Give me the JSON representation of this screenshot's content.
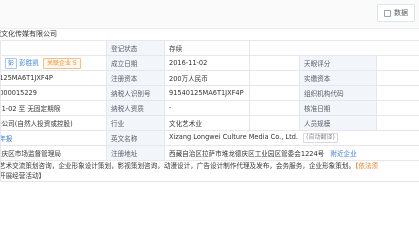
{
  "toolbar": {
    "export_label": "数据"
  },
  "company": {
    "name_partial": "瓏文化传媒有限公司"
  },
  "rows": [
    {
      "label1_partial": "",
      "value1": "",
      "label2": "登记状态",
      "value2": "存续",
      "label3": "",
      "value3": ""
    },
    {
      "legal_name_partial": "彭胜凯",
      "related_tag": "关联企业 5",
      "label2": "成立日期",
      "value2": "2016-11-02",
      "label3": "天眼评分",
      "value3": ""
    },
    {
      "value1_partial": "0125MA6T1JXF4P",
      "label2": "注册资本",
      "value2": "200万人民币",
      "label3": "实缴资本",
      "value3": ""
    },
    {
      "value1_partial": "2000015229",
      "label2": "纳税人识别号",
      "value2": "91540125MA6T1JXF4P",
      "label3": "组织机构代码",
      "value3": ""
    },
    {
      "value1_partial": "-11-02 至 无固定期限",
      "label2": "纳税人资质",
      "value2": "-",
      "label3": "核准日期",
      "value3": ""
    },
    {
      "value1_partial": "任公司(自然人投资或控股)",
      "label2": "行业",
      "value2": "文化艺术业",
      "label3": "人员规模",
      "value3": ""
    },
    {
      "value1_partial": "3年报",
      "label2": "英文名称",
      "value2": "Xizang Longwei Culture Media Co., Ltd.",
      "value2_tag": "(自动翻译)",
      "label3": "",
      "value3": ""
    },
    {
      "value1_partial": "德庆区市场监督管理局",
      "label2": "注册地址",
      "value2": "西藏自治区拉萨市堆龙德庆区工业园区管委会1224号",
      "value2_link": "附近企业",
      "label3": "",
      "value3": ""
    }
  ],
  "business_scope": {
    "line1": "艺术交流策划咨询，企业形象设计策划，影视策划咨询，动漫设计，广告设计制作代理及发布，会务服务，企业形象策划。【依法须",
    "line2": "开展经营活动】",
    "line1_highlight_start": "【依法须"
  }
}
